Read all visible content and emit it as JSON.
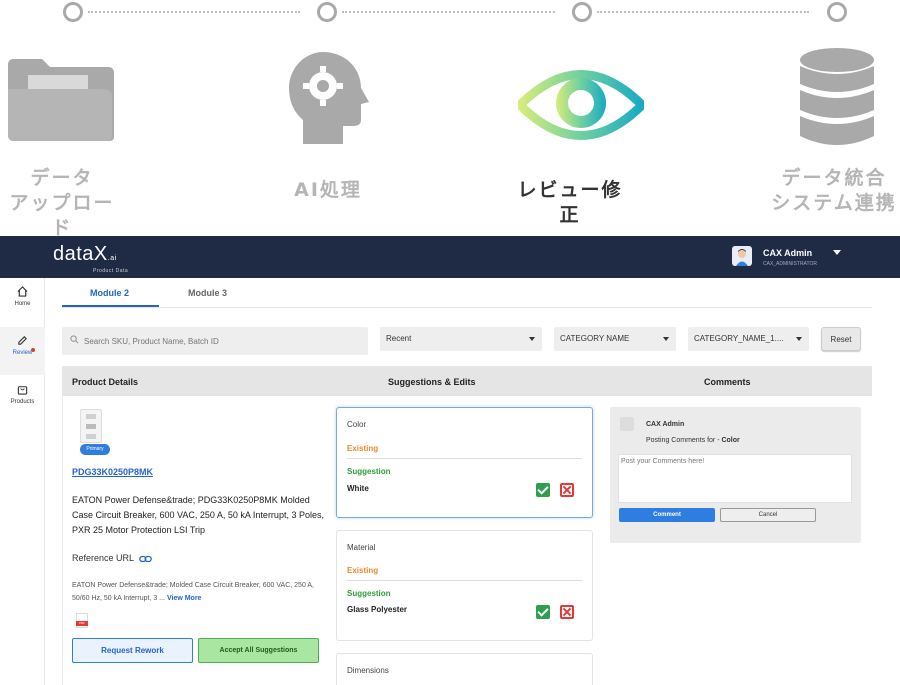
{
  "stepper": {
    "steps": [
      {
        "label_line1": "データ",
        "label_line2": "アップロード",
        "icon": "folder-icon"
      },
      {
        "label_line1": "AI処理",
        "label_line2": "",
        "icon": "ai-head-gear-icon"
      },
      {
        "label_line1": "レビュー修正",
        "label_line2": "",
        "icon": "eye-icon"
      },
      {
        "label_line1": "データ統合",
        "label_line2": "システム連携",
        "icon": "database-icon"
      }
    ],
    "active_index": 2
  },
  "app": {
    "logo_text": "dataX",
    "logo_ai": ".ai",
    "logo_sub": "Product Data",
    "user": {
      "name": "CAX Admin",
      "role": "CAX_ADMINISTRATOR"
    },
    "nav": [
      {
        "label": "Home",
        "icon": "home-icon"
      },
      {
        "label": "Review",
        "icon": "pencil-icon"
      },
      {
        "label": "Products",
        "icon": "bag-icon"
      }
    ],
    "tabs": [
      "Module 2",
      "Module 3"
    ],
    "active_tab": "Module 2",
    "search_placeholder": "Search SKU, Product Name, Batch ID",
    "filters": {
      "sort": "Recent",
      "category": "CATEGORY NAME",
      "category2": "CATEGORY_NAME_1...."
    },
    "reset_label": "Reset",
    "columns": [
      "Product Details",
      "Suggestions & Edits",
      "Comments"
    ],
    "product": {
      "badge": "Primary",
      "sku": "PDG33K0250P8MK",
      "title": "EATON Power Defense&trade; PDG33K0250P8MK Molded Case Circuit Breaker, 600 VAC, 250 A, 50 kA Interrupt, 3 Poles, PXR 25 Motor Protection LSI Trip",
      "reference_label": "Reference URL",
      "short_desc": "EATON Power Defense&trade; Molded Case Circuit Breaker, 600 VAC, 250 A, 50/60 Hz, 50 kA Interrupt, 3 ...",
      "view_more": "View More",
      "pdf_label": "PDF",
      "request_rework": "Request Rework",
      "accept_all": "Accept All Suggestions"
    },
    "suggestions": [
      {
        "attribute": "Color",
        "existing_label": "Existing",
        "existing_value": "",
        "suggestion_label": "Suggestion",
        "suggestion_value": "White"
      },
      {
        "attribute": "Material",
        "existing_label": "Existing",
        "existing_value": "",
        "suggestion_label": "Suggestion",
        "suggestion_value": "Glass Polyester"
      },
      {
        "attribute": "Dimensions"
      }
    ],
    "comments": {
      "author": "CAX Admin",
      "posting_prefix": "Posting Comments for - ",
      "posting_attr": "Color",
      "placeholder": "Post your Comments here!",
      "comment_label": "Comment",
      "cancel_label": "Cancel"
    }
  },
  "colors": {
    "navy": "#1f2a44",
    "accent": "#2563c9",
    "existing": "#e8892b",
    "suggestion": "#2e9e3a",
    "reject": "#e53935"
  }
}
